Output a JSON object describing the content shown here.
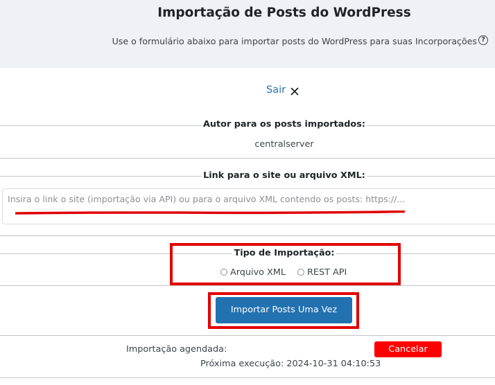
{
  "header": {
    "title": "Importação de Posts do WordPress",
    "subtitle": "Use o formulário abaixo para importar posts do WordPress para suas Incorporações",
    "help_icon": "question-circle-icon"
  },
  "exit": {
    "label": "Sair",
    "icon": "close-icon"
  },
  "author": {
    "label": "Autor para os posts importados:",
    "value": "centralserver"
  },
  "link": {
    "label": "Link para o site ou arquivo XML:",
    "placeholder": "Insira o link o site (importação via API) ou para o arquivo XML contendo os posts: https://..."
  },
  "import_type": {
    "label": "Tipo de Importação:",
    "options": [
      "Arquivo XML",
      "REST API"
    ]
  },
  "import_button": {
    "label": "Importar Posts Uma Vez"
  },
  "schedule": {
    "label": "Importação agendada:",
    "value": "",
    "cancel_label": "Cancelar",
    "next_run": "Próxima execução: 2024-10-31 04:10:53"
  },
  "colors": {
    "header_bg": "#eef1f5",
    "accent_blue": "#2271b1",
    "annotation_red": "#e00000",
    "cancel_red": "#ff0000"
  }
}
